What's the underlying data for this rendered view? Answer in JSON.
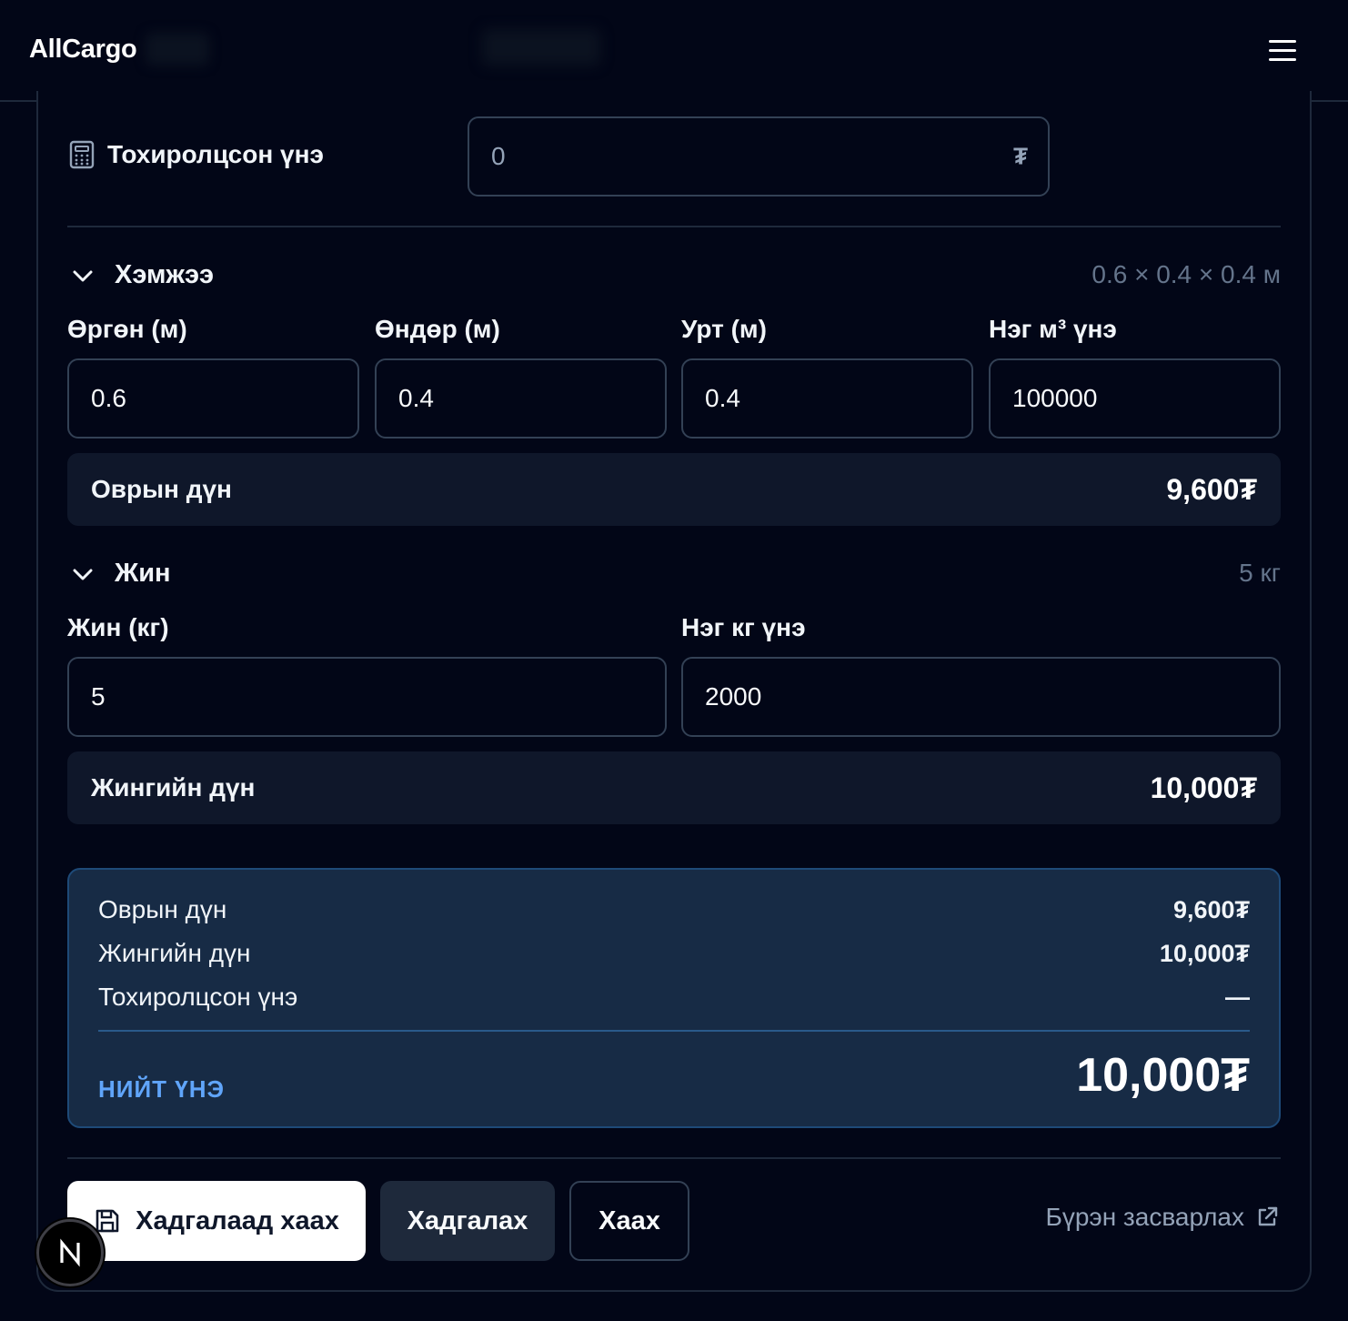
{
  "header": {
    "brand": "AllCargo"
  },
  "agreed_price": {
    "label": "Тохиролцсон үнэ",
    "value": "0",
    "suffix": "₮"
  },
  "dimensions": {
    "title": "Хэмжээ",
    "summary": "0.6 × 0.4 × 0.4 м",
    "fields": [
      {
        "label": "Өргөн (м)",
        "value": "0.6"
      },
      {
        "label": "Өндөр (м)",
        "value": "0.4"
      },
      {
        "label": "Урт (м)",
        "value": "0.4"
      },
      {
        "label": "Нэг м³ үнэ",
        "value": "100000"
      }
    ],
    "result_label": "Оврын дүн",
    "result_value": "9,600₮"
  },
  "weight": {
    "title": "Жин",
    "summary": "5 кг",
    "fields": [
      {
        "label": "Жин (кг)",
        "value": "5"
      },
      {
        "label": "Нэг кг үнэ",
        "value": "2000"
      }
    ],
    "result_label": "Жингийн дүн",
    "result_value": "10,000₮"
  },
  "totals": {
    "rows": [
      {
        "label": "Оврын дүн",
        "value": "9,600₮"
      },
      {
        "label": "Жингийн дүн",
        "value": "10,000₮"
      },
      {
        "label": "Тохиролцсон үнэ",
        "value": "—"
      }
    ],
    "total_label": "НИЙТ ҮНЭ",
    "total_value": "10,000₮"
  },
  "actions": {
    "save_close": "Хадгалаад хаах",
    "save": "Хадгалах",
    "close": "Хаах",
    "full_edit": "Бүрэн засварлах"
  },
  "badge": {
    "letter": "N"
  },
  "colors": {
    "background": "#020617",
    "accent_blue": "#60a5fa",
    "total_box": "#172b45"
  }
}
